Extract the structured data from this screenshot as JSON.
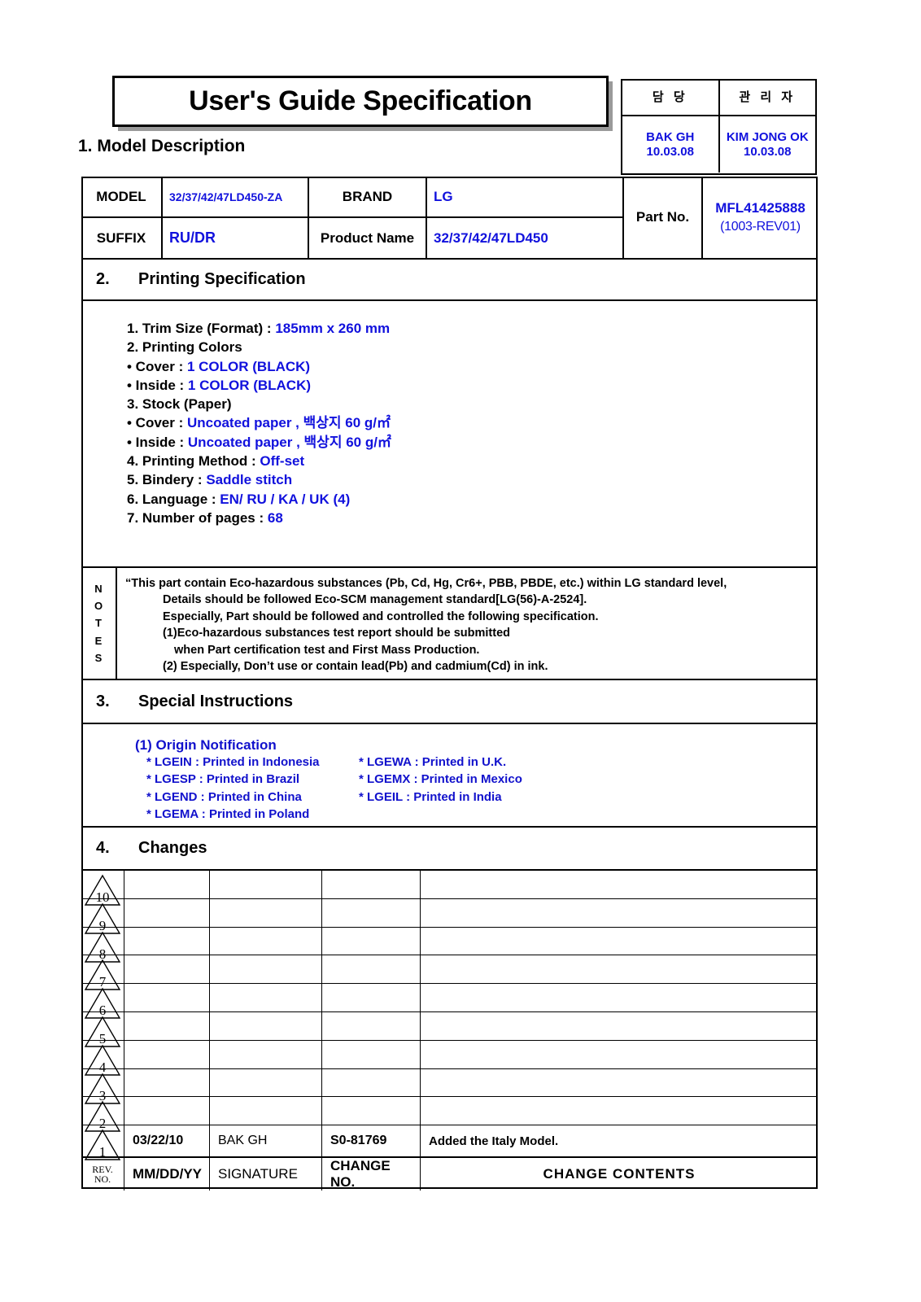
{
  "document": {
    "title": "User's Guide Specification"
  },
  "approval": {
    "columns": [
      {
        "label": "담 당",
        "name": "BAK GH",
        "date": "10.03.08"
      },
      {
        "label": "관 리 자",
        "name": "KIM JONG OK",
        "date": "10.03.08"
      }
    ]
  },
  "section1": {
    "heading": "1. Model Description",
    "labels": {
      "model": "MODEL",
      "suffix": "SUFFIX",
      "brand": "BRAND",
      "product_name": "Product Name",
      "part_no": "Part No."
    },
    "values": {
      "model": "32/37/42/47LD450-ZA",
      "suffix": "RU/DR",
      "brand": "LG",
      "product_name": "32/37/42/47LD450",
      "part_no": "MFL41425888",
      "part_no_rev": "(1003-REV01)"
    }
  },
  "section2": {
    "number": "2.",
    "heading": "Printing Specification",
    "lines": [
      {
        "label": "1. Trim Size (Format) : ",
        "value": "185mm x 260 mm"
      },
      {
        "label": "2. Printing Colors",
        "value": ""
      },
      {
        "label": "• Cover : ",
        "value": "1 COLOR (BLACK)"
      },
      {
        "label": "• Inside : ",
        "value": "1 COLOR (BLACK)"
      },
      {
        "label": "3. Stock (Paper)",
        "value": ""
      },
      {
        "label": "• Cover : ",
        "value": "Uncoated paper , 백상지 60 g/㎡"
      },
      {
        "label": "• Inside : ",
        "value": "Uncoated paper , 백상지 60 g/㎡"
      },
      {
        "label": "4. Printing Method : ",
        "value": "Off-set"
      },
      {
        "label": "5. Bindery  : ",
        "value": "Saddle stitch"
      },
      {
        "label": "6. Language : ",
        "value": "EN/ RU / KA / UK (4)"
      },
      {
        "label": "7. Number of pages : ",
        "value": "68"
      }
    ]
  },
  "notes": {
    "label": "NOTES",
    "lines": [
      {
        "indent": 0,
        "text": "“This part contain Eco-hazardous substances (Pb, Cd, Hg, Cr6+, PBB, PBDE, etc.) within LG standard level,"
      },
      {
        "indent": 1,
        "text": "Details should be followed Eco-SCM management standard[LG(56)-A-2524]."
      },
      {
        "indent": 1,
        "text": "Especially, Part should be followed and controlled the following specification."
      },
      {
        "indent": 1,
        "text": "(1)Eco-hazardous substances test report should be submitted"
      },
      {
        "indent": 2,
        "text": "when  Part certification test and First Mass Production."
      },
      {
        "indent": 1,
        "text": "(2) Especially, Don’t use or contain lead(Pb) and cadmium(Cd) in ink."
      }
    ]
  },
  "section3": {
    "number": "3.",
    "heading": "Special Instructions",
    "origin_title": "(1) Origin Notification",
    "origins": [
      {
        "left": "* LGEIN : Printed in Indonesia",
        "right": "* LGEWA : Printed in U.K."
      },
      {
        "left": "* LGESP : Printed in Brazil",
        "right": "* LGEMX : Printed in Mexico"
      },
      {
        "left": "* LGEND : Printed in China",
        "right": " * LGEIL : Printed in India"
      },
      {
        "left": "* LGEMA : Printed in Poland",
        "right": ""
      }
    ]
  },
  "section4": {
    "number": "4.",
    "heading": "Changes",
    "rows": [
      {
        "rev": "10",
        "date": "",
        "signature": "",
        "change_no": "",
        "contents": ""
      },
      {
        "rev": "9",
        "date": "",
        "signature": "",
        "change_no": "",
        "contents": ""
      },
      {
        "rev": "8",
        "date": "",
        "signature": "",
        "change_no": "",
        "contents": ""
      },
      {
        "rev": "7",
        "date": "",
        "signature": "",
        "change_no": "",
        "contents": ""
      },
      {
        "rev": "6",
        "date": "",
        "signature": "",
        "change_no": "",
        "contents": ""
      },
      {
        "rev": "5",
        "date": "",
        "signature": "",
        "change_no": "",
        "contents": ""
      },
      {
        "rev": "4",
        "date": "",
        "signature": "",
        "change_no": "",
        "contents": ""
      },
      {
        "rev": "3",
        "date": "",
        "signature": "",
        "change_no": "",
        "contents": ""
      },
      {
        "rev": "2",
        "date": "",
        "signature": "",
        "change_no": "",
        "contents": ""
      },
      {
        "rev": "1",
        "date": "03/22/10",
        "signature": "BAK GH",
        "change_no": "S0-81769",
        "contents": "Added the Italy Model."
      }
    ],
    "footer": {
      "rev_no_line1": "REV.",
      "rev_no_line2": "NO.",
      "date": "MM/DD/YY",
      "signature": "SIGNATURE",
      "change_no": "CHANGE NO.",
      "contents": "CHANGE   CONTENTS"
    }
  },
  "colors": {
    "blue": "#1111dd",
    "black": "#000000"
  }
}
